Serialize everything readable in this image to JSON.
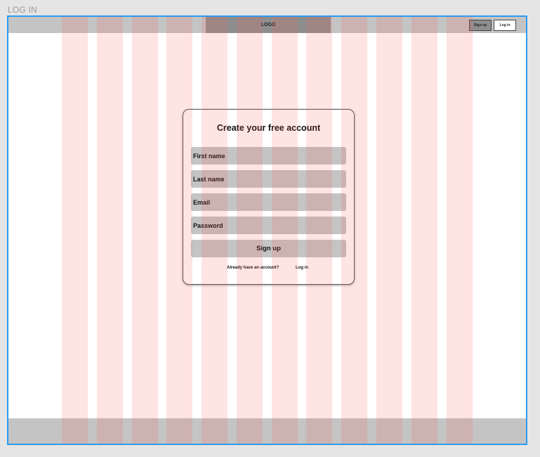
{
  "page": {
    "label": "LOG IN"
  },
  "header": {
    "logo": "LOGO",
    "signup_label": "Sign up",
    "login_label": "Log in"
  },
  "form": {
    "title": "Create your free account",
    "first_name": "First name",
    "last_name": "Last name",
    "email": "Email",
    "password": "Password",
    "submit_label": "Sign up",
    "prompt": "Already have an account?",
    "login_link": "Log in"
  },
  "colors": {
    "frame_border": "#2e9bf0",
    "grid_column": "#ff5a5a",
    "bar": "#c4c4c4",
    "logo_block": "#8e8e8e"
  }
}
